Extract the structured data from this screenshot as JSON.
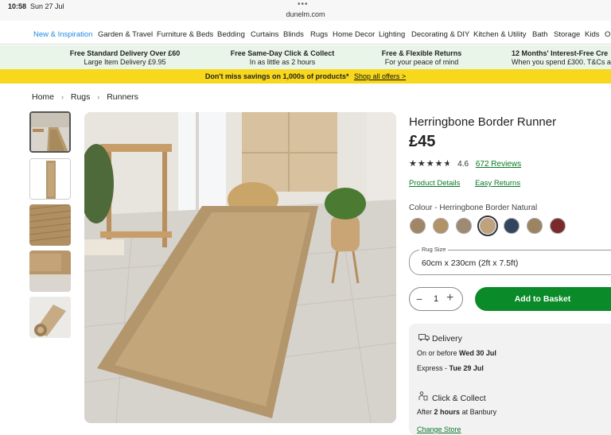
{
  "status": {
    "time": "10:58",
    "date": "Sun 27 Jul",
    "dots": "•••",
    "url": "dunelm.com"
  },
  "nav": [
    "New & Inspiration",
    "Garden & Travel",
    "Furniture & Beds",
    "Bedding",
    "Curtains",
    "Blinds",
    "Rugs",
    "Home Decor",
    "Lighting",
    "Decorating & DIY",
    "Kitchen & Utility",
    "Bath",
    "Storage",
    "Kids",
    "O"
  ],
  "benefits": [
    {
      "title": "Free Standard Delivery Over £60",
      "sub": "Large Item Delivery £9.95"
    },
    {
      "title": "Free Same-Day Click & Collect",
      "sub": "In as little as 2 hours"
    },
    {
      "title": "Free & Flexible Returns",
      "sub": "For your peace of mind"
    },
    {
      "title": "12 Months' Interest-Free Cre",
      "sub": "When you spend £300. T&Cs a"
    }
  ],
  "promo": {
    "text": "Don't miss savings on 1,000s of products*",
    "link": "Shop all offers >"
  },
  "breadcrumb": [
    "Home",
    "Rugs",
    "Runners"
  ],
  "breadcrumb_sep": "›",
  "product": {
    "title": "Herringbone Border Runner",
    "price": "£45",
    "stars": "★★★★★",
    "rating": "4.6",
    "rating_value": 4.6,
    "reviews": "672 Reviews",
    "links": [
      "Product Details",
      "Easy Returns"
    ],
    "colour_label": "Colour - Herringbone Border Natural",
    "swatches": [
      "#a08664",
      "#b29368",
      "#9d8a72",
      "#c2a27a",
      "#33455e",
      "#9c8463",
      "#7a2a2a"
    ],
    "selected_swatch": 3,
    "size_label": "Rug Size",
    "size_value": "60cm x 230cm (2ft x 7.5ft)",
    "qty": "1",
    "minus": "−",
    "plus": "+",
    "basket": "Add to Basket"
  },
  "delivery": {
    "title": "Delivery",
    "line1_pre": "On or before",
    "line1_bold": "Wed 30 Jul",
    "line2_pre": "Express -",
    "line2_bold": "Tue 29 Jul",
    "cc_title": "Click & Collect",
    "cc_pre": "After",
    "cc_bold": "2 hours",
    "cc_post": "at Banbury",
    "store": "Change Store"
  },
  "colors": {
    "green": "#0a8a28",
    "promo_yellow": "#f8d81c",
    "benefit_bg": "#eaf5ea",
    "nav_active": "#1e88e5"
  }
}
